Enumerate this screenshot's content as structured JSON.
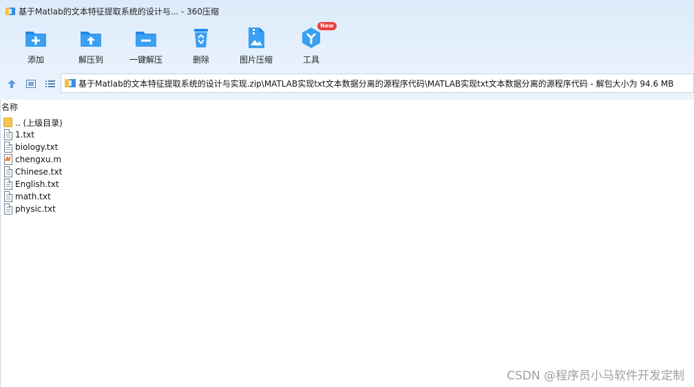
{
  "window": {
    "title": "基于Matlab的文本特征提取系统的设计与... - 360压缩"
  },
  "toolbar": {
    "items": [
      {
        "label": "添加",
        "icon": "add-folder-icon"
      },
      {
        "label": "解压到",
        "icon": "extract-to-icon"
      },
      {
        "label": "一键解压",
        "icon": "one-click-extract-icon"
      },
      {
        "label": "删除",
        "icon": "recycle-bin-icon"
      },
      {
        "label": "图片压缩",
        "icon": "image-compress-icon"
      },
      {
        "label": "工具",
        "icon": "tools-icon",
        "badge": "New"
      }
    ]
  },
  "nav": {
    "path": "基于Matlab的文本特征提取系统的设计与实现.zip\\MATLAB实现txt文本数据分离的源程序代码\\MATLAB实现txt文本数据分离的源程序代码 - 解包大小为 94.6 MB"
  },
  "list": {
    "column_name": "名称",
    "files": [
      {
        "name": ".. (上级目录)",
        "type": "parent"
      },
      {
        "name": "1.txt",
        "type": "txt"
      },
      {
        "name": "biology.txt",
        "type": "txt"
      },
      {
        "name": "chengxu.m",
        "type": "m"
      },
      {
        "name": "Chinese.txt",
        "type": "txt"
      },
      {
        "name": "English.txt",
        "type": "txt"
      },
      {
        "name": "math.txt",
        "type": "txt"
      },
      {
        "name": "physic.txt",
        "type": "txt"
      }
    ]
  },
  "watermark": "CSDN @程序员小马软件开发定制",
  "colors": {
    "accent": "#2f8fe6",
    "chrome_bg": "#e3effb",
    "badge": "#e8413d"
  }
}
